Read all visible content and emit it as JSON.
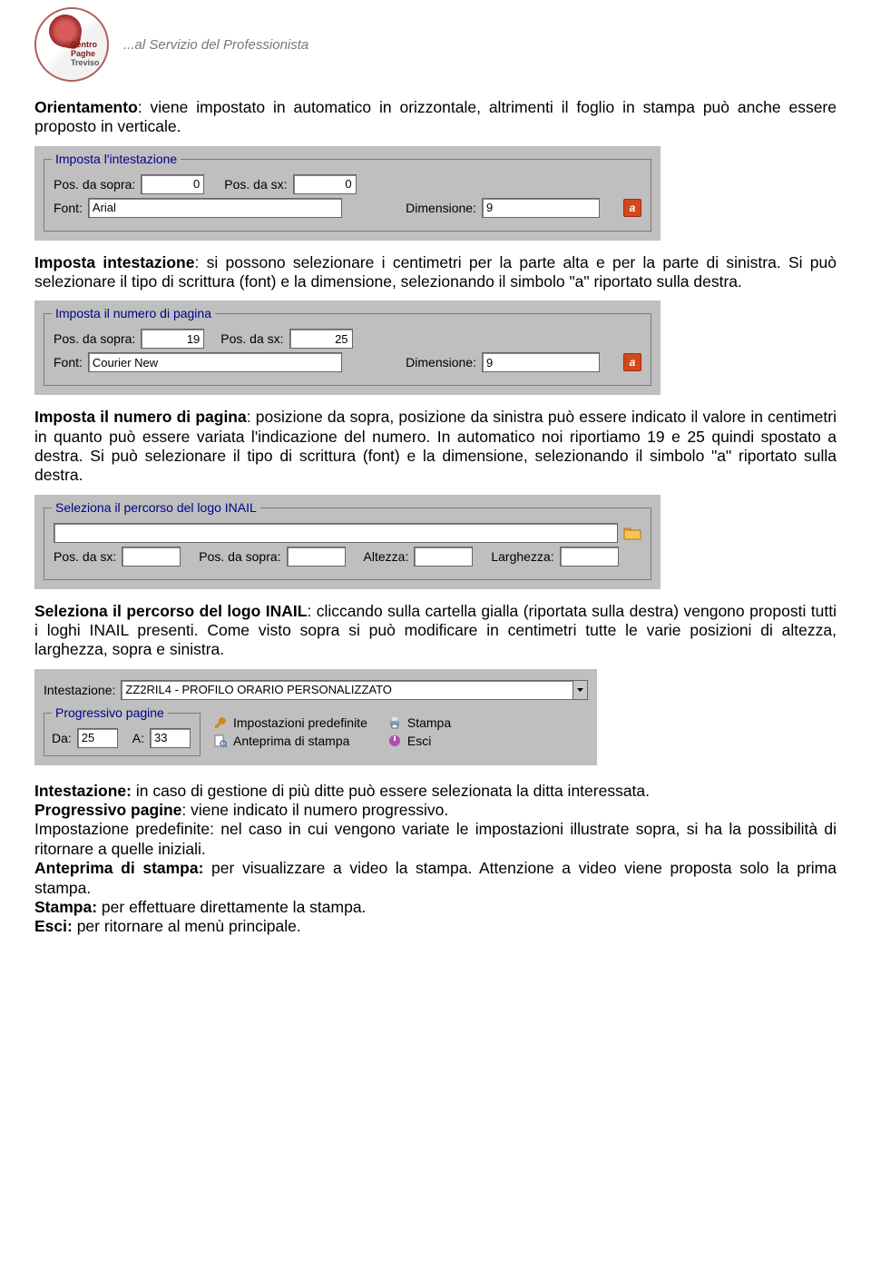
{
  "logo": {
    "line1": "Centro",
    "line2": "Paghe",
    "line3": "Treviso",
    "slogan": "...al Servizio del Professionista"
  },
  "para1": {
    "bold": "Orientamento",
    "rest": ": viene impostato in automatico in orizzontale, altrimenti il foglio in stampa può anche essere proposto in verticale."
  },
  "panel1": {
    "legend": "Imposta l'intestazione",
    "pos_sopra_lbl": "Pos. da sopra:",
    "pos_sopra_val": "0",
    "pos_sx_lbl": "Pos. da sx:",
    "pos_sx_val": "0",
    "font_lbl": "Font:",
    "font_val": "Arial",
    "dim_lbl": "Dimensione:",
    "dim_val": "9"
  },
  "para2": {
    "bold": "Imposta intestazione",
    "rest": ": si possono selezionare i centimetri per la parte alta e per la parte di sinistra. Si può selezionare il tipo di scrittura (font) e la dimensione, selezionando il simbolo \"a\" riportato sulla destra."
  },
  "panel2": {
    "legend": "Imposta il numero di pagina",
    "pos_sopra_lbl": "Pos. da sopra:",
    "pos_sopra_val": "19",
    "pos_sx_lbl": "Pos. da sx:",
    "pos_sx_val": "25",
    "font_lbl": "Font:",
    "font_val": "Courier New",
    "dim_lbl": "Dimensione:",
    "dim_val": "9"
  },
  "para3": {
    "bold": "Imposta il numero di pagina",
    "rest": ": posizione da sopra, posizione da sinistra può essere indicato il valore in centimetri in quanto può essere variata l'indicazione del numero. In automatico noi riportiamo 19 e 25 quindi spostato a destra. Si può selezionare il tipo di scrittura (font) e la dimensione, selezionando il simbolo \"a\" riportato sulla destra."
  },
  "panel3": {
    "legend": "Seleziona il percorso del logo INAIL",
    "path_val": "",
    "pos_sx_lbl": "Pos. da sx:",
    "pos_sx_val": "",
    "pos_sopra_lbl": "Pos. da sopra:",
    "pos_sopra_val": "",
    "altezza_lbl": "Altezza:",
    "altezza_val": "",
    "larghezza_lbl": "Larghezza:",
    "larghezza_val": ""
  },
  "para4": {
    "bold": "Seleziona il percorso del logo INAIL",
    "rest": ": cliccando sulla cartella gialla (riportata sulla destra) vengono proposti tutti i loghi INAIL presenti. Come visto sopra si può modificare in centimetri tutte le varie posizioni di altezza, larghezza, sopra e sinistra."
  },
  "panel4": {
    "intestazione_lbl": "Intestazione:",
    "intestazione_val": "ZZ2RIL4 - PROFILO ORARIO PERSONALIZZATO",
    "progressivo_legend": "Progressivo pagine",
    "da_lbl": "Da:",
    "da_val": "25",
    "a_lbl": "A:",
    "a_val": "33",
    "impostazioni": "Impostazioni predefinite",
    "stampa": "Stampa",
    "anteprima": "Anteprima di stampa",
    "esci": "Esci"
  },
  "para5": {
    "b1": "Intestazione:",
    "t1": " in caso di gestione di più ditte può essere selezionata la ditta interessata.",
    "b2": "Progressivo pagine",
    "t2": ": viene indicato il numero progressivo.",
    "t3": "Impostazione predefinite: nel caso in cui vengono variate le impostazioni illustrate sopra, si ha la possibilità di ritornare a quelle iniziali.",
    "b4": "Anteprima di stampa:",
    "t4": " per visualizzare a video la stampa. Attenzione a video viene proposta solo la prima stampa.",
    "b5": "Stampa:",
    "t5": " per effettuare direttamente la stampa.",
    "b6": "Esci:",
    "t6": " per ritornare al menù principale."
  }
}
